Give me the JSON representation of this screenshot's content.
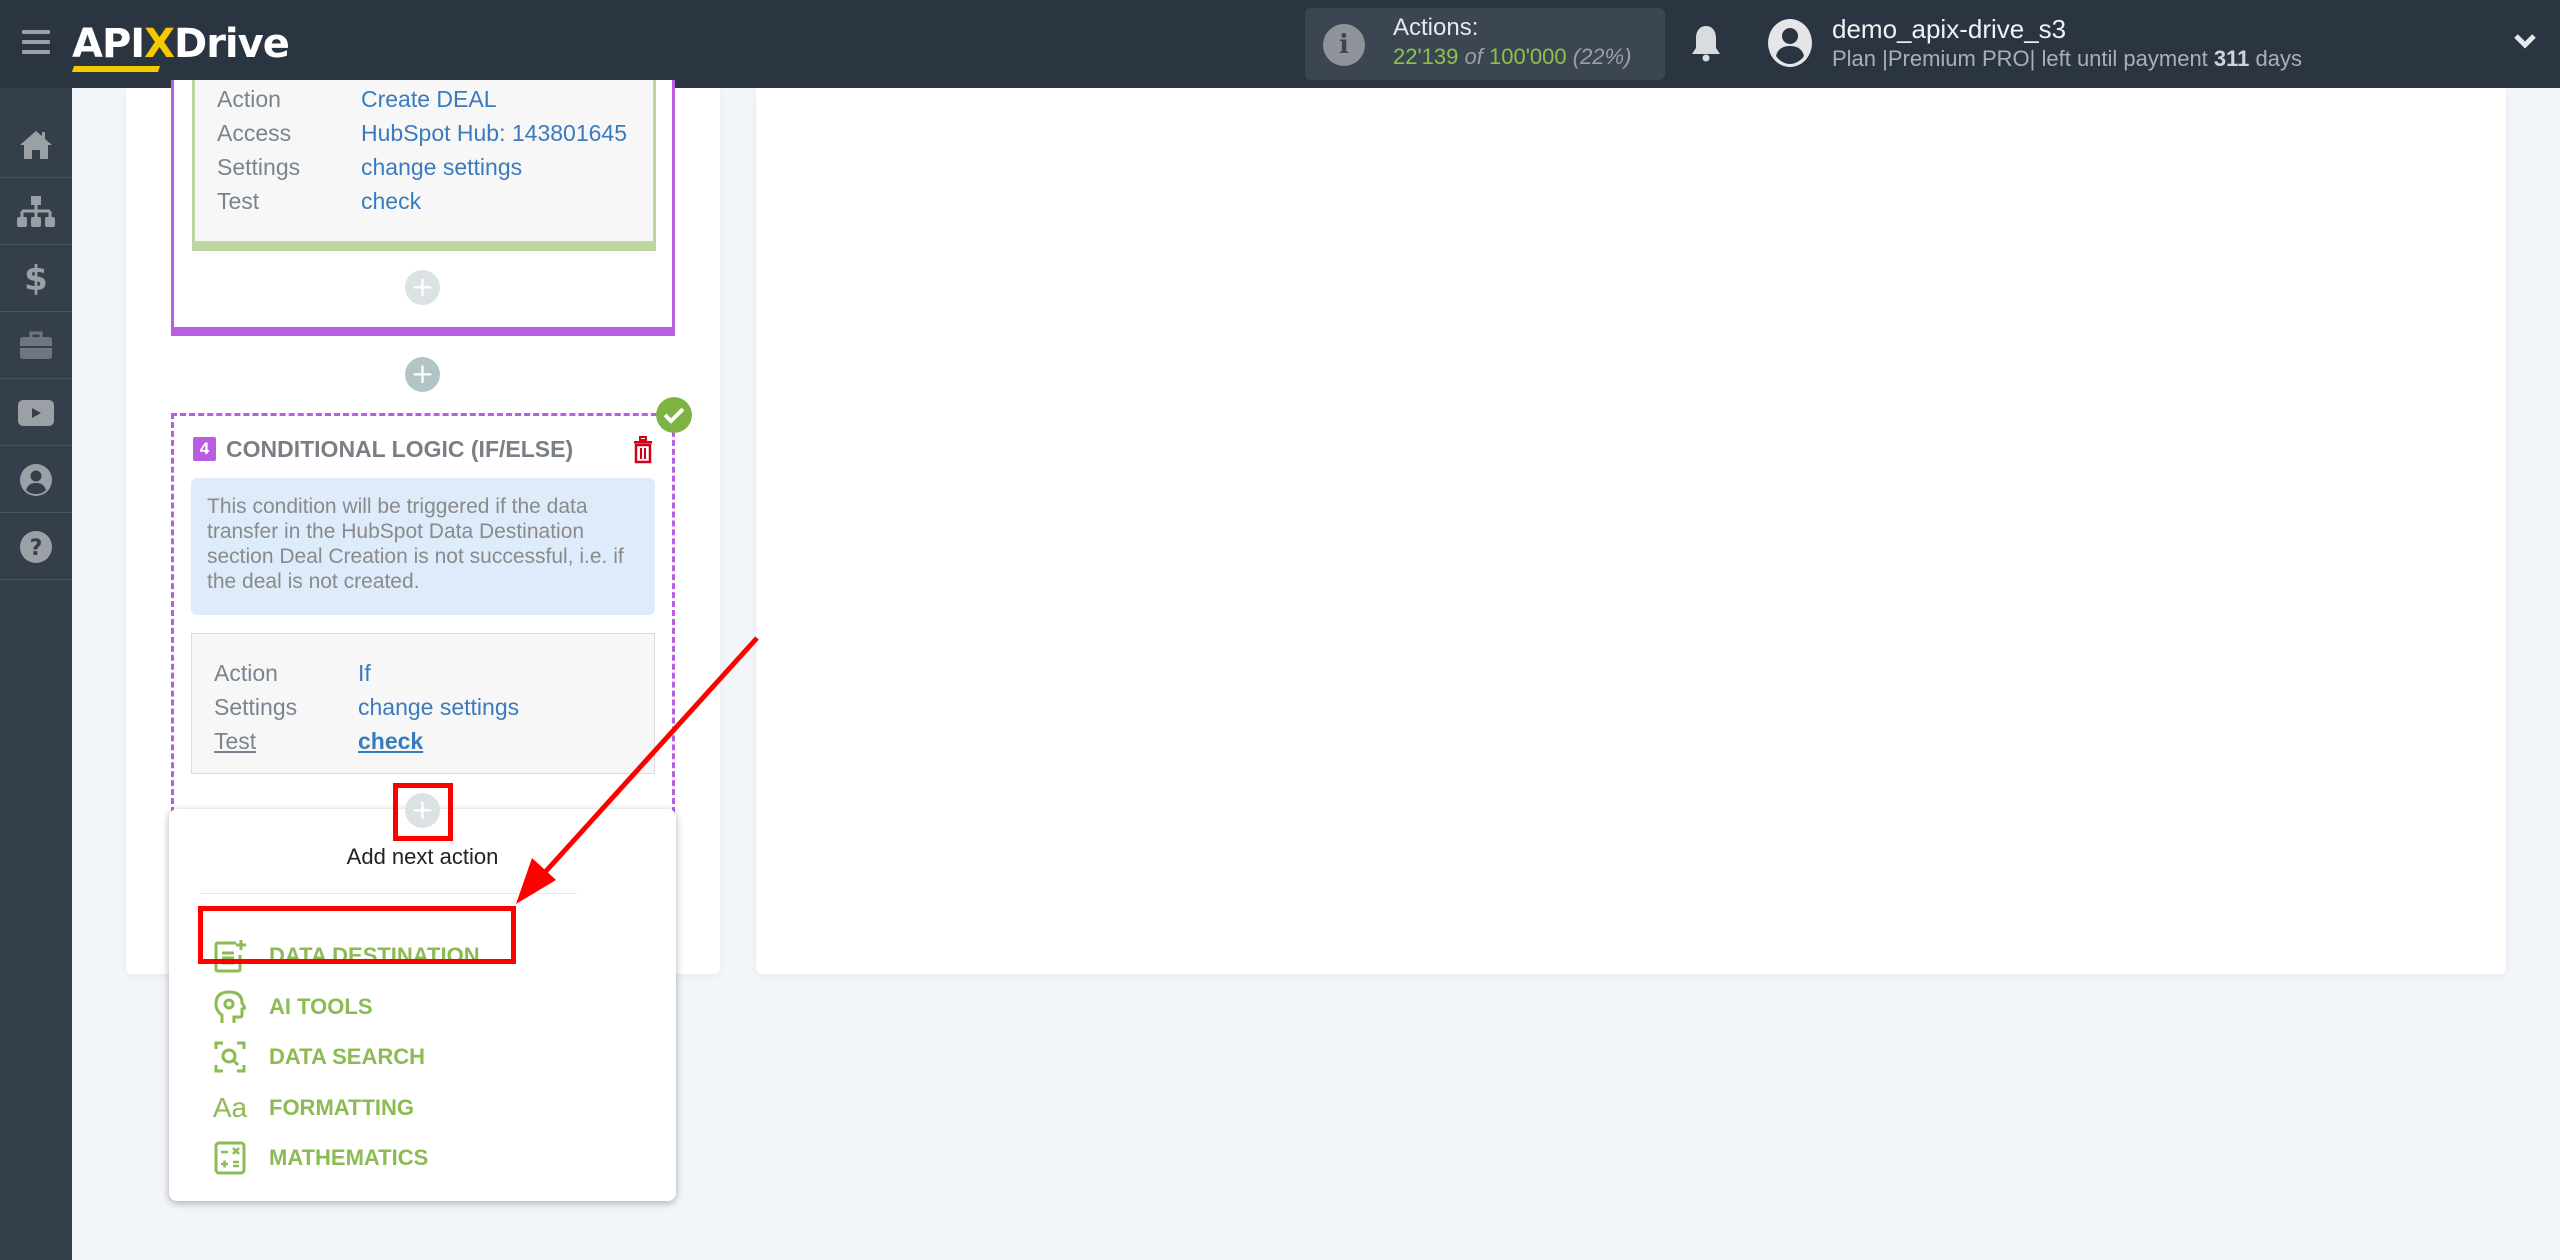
{
  "header": {
    "logo": {
      "part1": "API",
      "part2": "X",
      "part3": "Drive"
    },
    "actions": {
      "label": "Actions:",
      "used": "22'139",
      "of": "of",
      "total": "100'000",
      "percent": "(22%)",
      "progress_fraction": 0.22
    },
    "user": {
      "name": "demo_apix-drive_s3",
      "plan_prefix": "Plan |Premium PRO| left until payment",
      "days_left": "311",
      "days_suffix": "days"
    }
  },
  "sidebar": {
    "items": [
      {
        "name": "home",
        "icon": "home-icon"
      },
      {
        "name": "connections",
        "icon": "sitemap-icon"
      },
      {
        "name": "billing",
        "icon": "dollar-icon"
      },
      {
        "name": "tools",
        "icon": "briefcase-icon"
      },
      {
        "name": "videos",
        "icon": "youtube-icon"
      },
      {
        "name": "account",
        "icon": "user-circle-icon"
      },
      {
        "name": "help",
        "icon": "question-circle-icon"
      }
    ]
  },
  "block3": {
    "rows": [
      {
        "key": "Action",
        "value": "Create DEAL"
      },
      {
        "key": "Access",
        "value": "HubSpot Hub: 143801645"
      },
      {
        "key": "Settings",
        "value": "change settings"
      },
      {
        "key": "Test",
        "value": "check"
      }
    ],
    "add_label": "+"
  },
  "between_add_label": "+",
  "block4": {
    "number": "4",
    "title": "CONDITIONAL LOGIC (IF/ELSE)",
    "description": "This condition will be triggered if the data transfer in the HubSpot Data Destination section Deal Creation is not successful, i.e. if the deal is not created.",
    "rows": [
      {
        "key": "Action",
        "value": "If"
      },
      {
        "key": "Settings",
        "value": "change settings"
      },
      {
        "key": "Test",
        "value": "check"
      }
    ],
    "add_label": "+"
  },
  "dropdown": {
    "title": "Add next action",
    "items": [
      {
        "label": "DATA DESTINATION",
        "icon": "data-destination-icon"
      },
      {
        "label": "AI TOOLS",
        "icon": "ai-tools-icon"
      },
      {
        "label": "DATA SEARCH",
        "icon": "data-search-icon"
      },
      {
        "label": "FORMATTING",
        "icon": "formatting-icon",
        "glyph": "Aa"
      },
      {
        "label": "MATHEMATICS",
        "icon": "mathematics-icon"
      }
    ]
  },
  "colors": {
    "topbar": "#2b3542",
    "sidebar": "#353f4c",
    "accent_purple": "#b95ee0",
    "accent_green": "#8bbb52",
    "link_blue": "#3a7bbd",
    "annotation_red": "#ff0000"
  }
}
